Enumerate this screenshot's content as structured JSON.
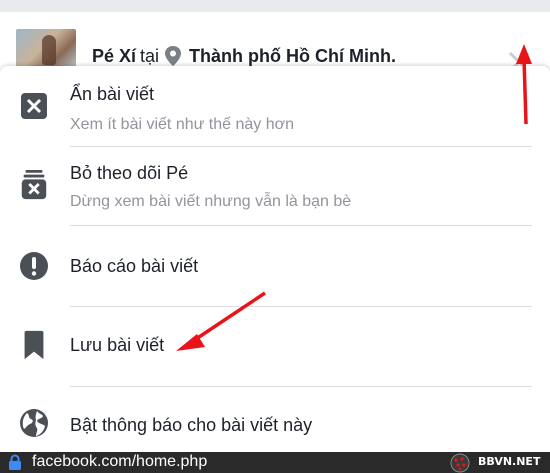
{
  "post": {
    "author": "Pé Xí",
    "at_word": "tại",
    "location": "Thành phố Hồ Chí Minh."
  },
  "icons": {
    "avatar": "profile-photo",
    "pin": "location-pin-icon",
    "close": "close-icon",
    "lock": "lock-icon"
  },
  "menu": {
    "items": [
      {
        "title": "Ẩn bài viết",
        "subtitle": "Xem ít bài viết như thế này hơn",
        "icon": "hide-post-icon"
      },
      {
        "title": "Bỏ theo dõi Pé",
        "subtitle": "Dừng xem bài viết nhưng vẫn là bạn bè",
        "icon": "unfollow-icon"
      },
      {
        "title": "Báo cáo bài viết",
        "subtitle": "",
        "icon": "report-icon"
      },
      {
        "title": "Lưu bài viết",
        "subtitle": "",
        "icon": "bookmark-icon"
      },
      {
        "title": "Bật thông báo cho bài viết này",
        "subtitle": "",
        "icon": "globe-icon"
      }
    ]
  },
  "browser": {
    "url": "facebook.com/home.php"
  },
  "watermark": {
    "text": "BBVN.NET"
  },
  "colors": {
    "icon_gray": "#4b4f56",
    "subtitle_gray": "#90949c",
    "annotation_red": "#e8141a",
    "url_bar": "#2a2a2a"
  }
}
